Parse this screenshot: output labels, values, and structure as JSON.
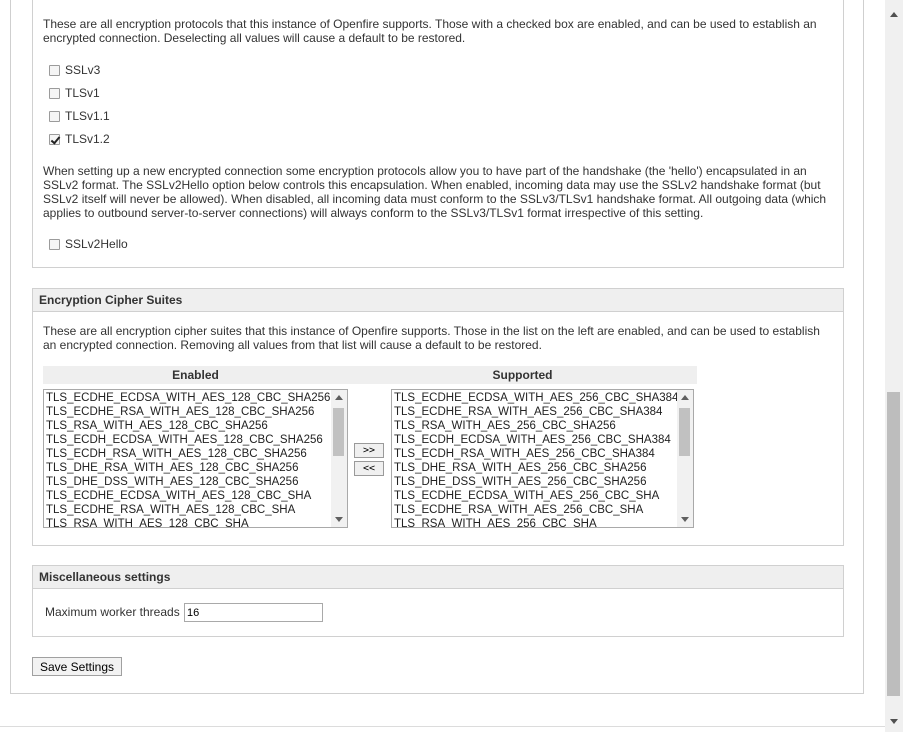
{
  "protocols": {
    "description": "These are all encryption protocols that this instance of Openfire supports. Those with a checked box are enabled, and can be used to establish an encrypted connection. Deselecting all values will cause a default to be restored.",
    "items": [
      {
        "label": "SSLv3",
        "checked": false
      },
      {
        "label": "TLSv1",
        "checked": false
      },
      {
        "label": "TLSv1.1",
        "checked": false
      },
      {
        "label": "TLSv1.2",
        "checked": true
      }
    ],
    "hello_description": "When setting up a new encrypted connection some encryption protocols allow you to have part of the handshake (the 'hello') encapsulated in an SSLv2 format. The SSLv2Hello option below controls this encapsulation. When enabled, incoming data may use the SSLv2 handshake format (but SSLv2 itself will never be allowed). When disabled, all incoming data must conform to the SSLv3/TLSv1 handshake format. All outgoing data (which applies to outbound server-to-server connections) will always conform to the SSLv3/TLSv1 format irrespective of this setting.",
    "hello": {
      "label": "SSLv2Hello",
      "checked": false
    }
  },
  "ciphers": {
    "title": "Encryption Cipher Suites",
    "description": "These are all encryption cipher suites that this instance of Openfire supports. Those in the list on the left are enabled, and can be used to establish an encrypted connection. Removing all values from that list will cause a default to be restored.",
    "enabled_header": "Enabled",
    "supported_header": "Supported",
    "enabled": [
      "TLS_ECDHE_ECDSA_WITH_AES_128_CBC_SHA256",
      "TLS_ECDHE_RSA_WITH_AES_128_CBC_SHA256",
      "TLS_RSA_WITH_AES_128_CBC_SHA256",
      "TLS_ECDH_ECDSA_WITH_AES_128_CBC_SHA256",
      "TLS_ECDH_RSA_WITH_AES_128_CBC_SHA256",
      "TLS_DHE_RSA_WITH_AES_128_CBC_SHA256",
      "TLS_DHE_DSS_WITH_AES_128_CBC_SHA256",
      "TLS_ECDHE_ECDSA_WITH_AES_128_CBC_SHA",
      "TLS_ECDHE_RSA_WITH_AES_128_CBC_SHA",
      "TLS_RSA_WITH_AES_128_CBC_SHA"
    ],
    "supported": [
      "TLS_ECDHE_ECDSA_WITH_AES_256_CBC_SHA384",
      "TLS_ECDHE_RSA_WITH_AES_256_CBC_SHA384",
      "TLS_RSA_WITH_AES_256_CBC_SHA256",
      "TLS_ECDH_ECDSA_WITH_AES_256_CBC_SHA384",
      "TLS_ECDH_RSA_WITH_AES_256_CBC_SHA384",
      "TLS_DHE_RSA_WITH_AES_256_CBC_SHA256",
      "TLS_DHE_DSS_WITH_AES_256_CBC_SHA256",
      "TLS_ECDHE_ECDSA_WITH_AES_256_CBC_SHA",
      "TLS_ECDHE_RSA_WITH_AES_256_CBC_SHA",
      "TLS_RSA_WITH_AES_256_CBC_SHA"
    ],
    "add_label": ">>",
    "remove_label": "<<"
  },
  "misc": {
    "title": "Miscellaneous settings",
    "threads_label": "Maximum worker threads",
    "threads_value": "16"
  },
  "save_label": "Save Settings"
}
